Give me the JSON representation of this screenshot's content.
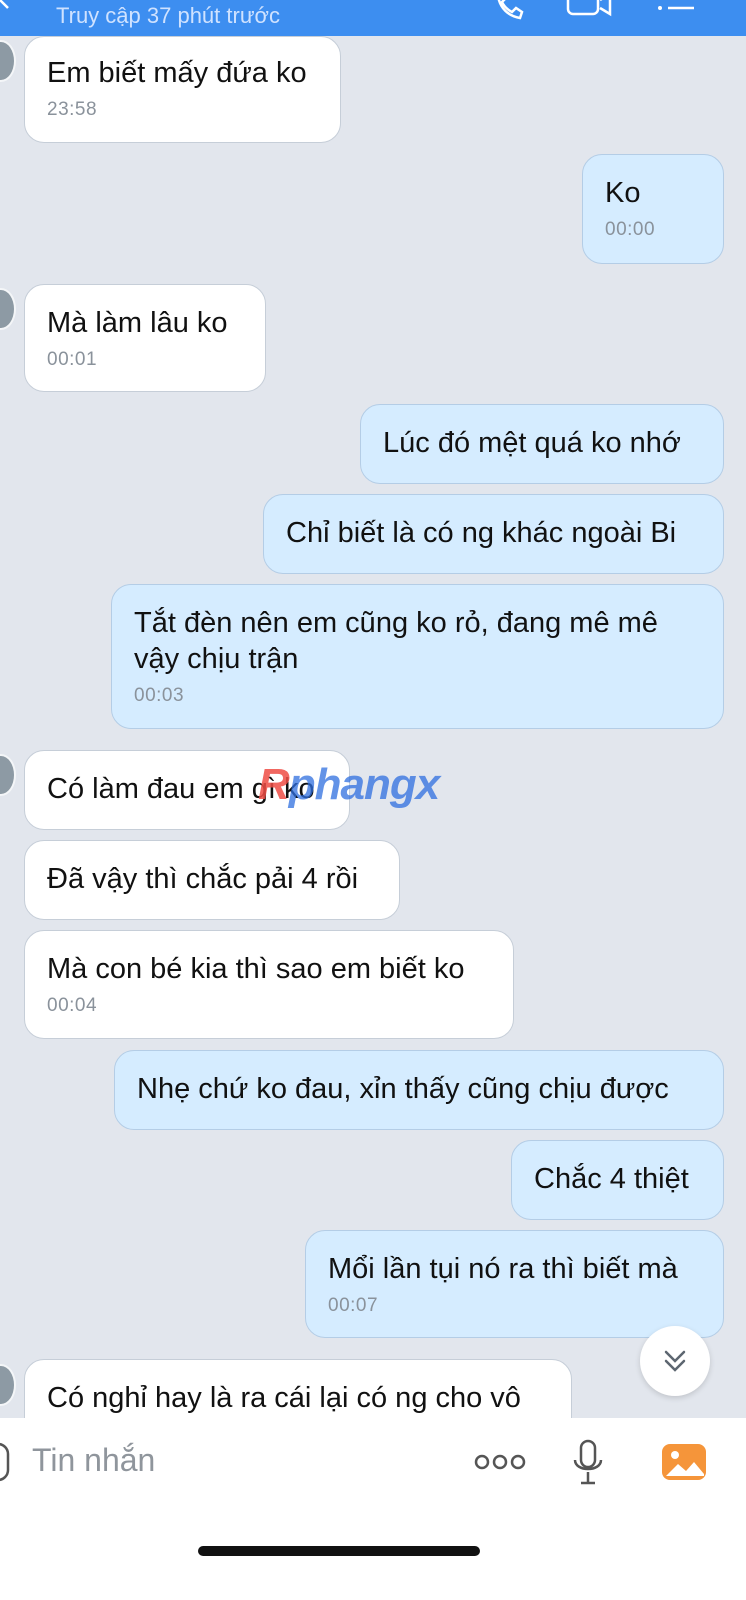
{
  "header": {
    "status": "Truy cập 37 phút trước"
  },
  "messages": [
    {
      "side": "in",
      "text": "Em biết mấy đứa ko",
      "time": "23:58"
    },
    {
      "side": "out",
      "text": "Ko",
      "time": "00:00"
    },
    {
      "side": "in",
      "text": "Mà làm lâu ko",
      "time": "00:01"
    },
    {
      "side": "out",
      "text": "Lúc đó mệt quá ko nhớ"
    },
    {
      "side": "out",
      "text": "Chỉ biết là có ng khác ngoài Bi"
    },
    {
      "side": "out",
      "text": "Tắt đèn nên em cũng ko rỏ, đang mê mê vậy chịu trận",
      "time": "00:03"
    },
    {
      "side": "in",
      "text": "Có làm đau em gì ko"
    },
    {
      "side": "in",
      "text": "Đã vậy thì chắc pải 4 rồi"
    },
    {
      "side": "in",
      "text": "Mà con bé kia thì sao em biết ko",
      "time": "00:04"
    },
    {
      "side": "out",
      "text": "Nhẹ chứ ko đau, xỉn thấy cũng chịu được"
    },
    {
      "side": "out",
      "text": "Chắc 4 thiệt"
    },
    {
      "side": "out",
      "text": "Mổi lần tụi nó ra thì biết mà",
      "time": "00:07"
    },
    {
      "side": "in",
      "text": "Có nghỉ hay là ra cái lại có ng cho vô"
    }
  ],
  "watermark": {
    "part1": "R",
    "part2": "phangx"
  },
  "composer": {
    "placeholder": "Tin nhắn"
  },
  "icons": {
    "back": "back-arrow-icon",
    "call": "phone-icon",
    "video": "video-camera-icon",
    "menu": "list-menu-icon",
    "scroll": "chevron-double-down-icon",
    "emoji": "emoji-icon",
    "more": "more-dots-icon",
    "mic": "microphone-icon",
    "image": "image-gallery-icon"
  },
  "colors": {
    "header": "#3d8ef0",
    "chat_bg": "#e2e6ed",
    "incoming_bubble": "#ffffff",
    "outgoing_bubble": "#d5ecff",
    "image_icon": "#f5953a"
  }
}
